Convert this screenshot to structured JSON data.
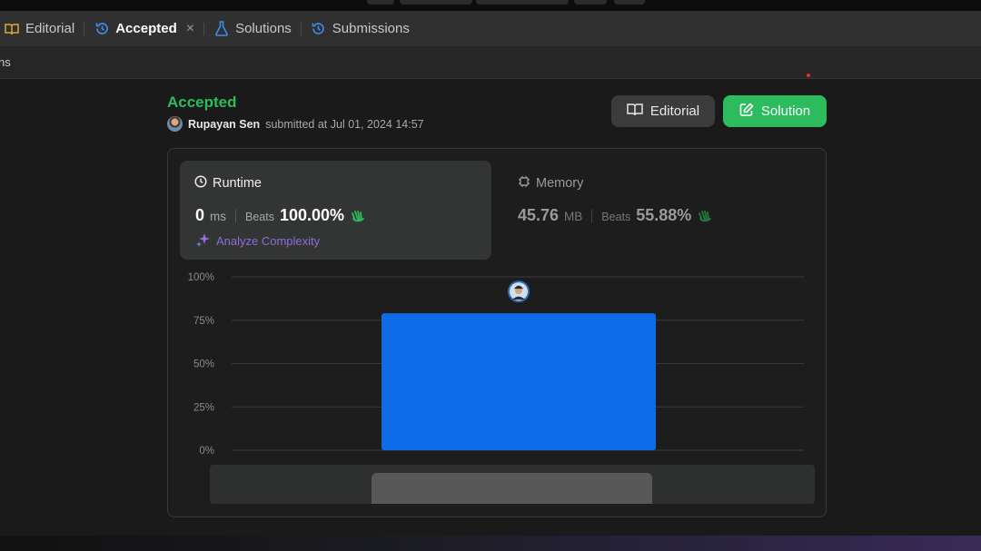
{
  "tabs": [
    {
      "label": "Editorial",
      "active": false
    },
    {
      "label": "Accepted",
      "active": true,
      "close": "×"
    },
    {
      "label": "Solutions",
      "active": false
    },
    {
      "label": "Submissions",
      "active": false
    }
  ],
  "subbar": {
    "cut_text": "ns"
  },
  "submission": {
    "status": "Accepted",
    "user": "Rupayan Sen",
    "submitted_text": "submitted at Jul 01, 2024 14:57"
  },
  "buttons": {
    "editorial": "Editorial",
    "solution": "Solution"
  },
  "runtime": {
    "label": "Runtime",
    "value": "0",
    "unit": "ms",
    "beats_label": "Beats",
    "beats_pct": "100.00%",
    "analyze": "Analyze Complexity"
  },
  "memory": {
    "label": "Memory",
    "value": "45.76",
    "unit": "MB",
    "beats_label": "Beats",
    "beats_pct": "55.88%"
  },
  "colors": {
    "accent_green": "#2cbb5d",
    "bar_blue": "#0f6ce8",
    "analyze_purple": "#8f6bd8"
  },
  "chart_data": {
    "type": "bar",
    "categories": [
      ""
    ],
    "values": [
      79
    ],
    "ylim": [
      0,
      100
    ],
    "yticks": [
      "0%",
      "25%",
      "50%",
      "75%",
      "100%"
    ],
    "grid": true
  }
}
